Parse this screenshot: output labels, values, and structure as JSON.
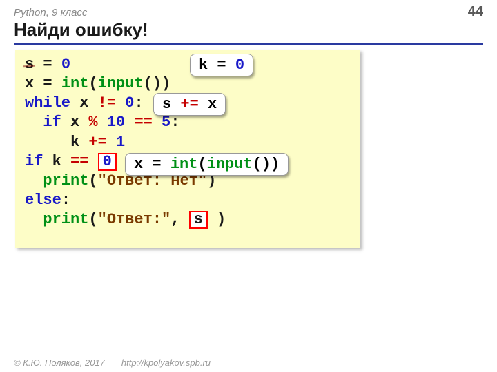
{
  "header": {
    "left": "Python, 9 класс",
    "page": "44"
  },
  "title": "Найди ошибку!",
  "code": {
    "l1": {
      "a": "s",
      "b": " = ",
      "c": "0"
    },
    "l2": {
      "a": "x = ",
      "b": "int",
      "c": "(",
      "d": "input",
      "e": "())"
    },
    "l3": {
      "a": "while",
      "b": " x ",
      "c": "!=",
      "d": " ",
      "e": "0",
      "f": ":"
    },
    "l4": {
      "a": "  ",
      "b": "if",
      "c": " x ",
      "d": "%",
      "e": " ",
      "f": "10",
      "g": " ",
      "h": "==",
      "i": " ",
      "j": "5",
      "k": ":"
    },
    "l5": {
      "a": "     k ",
      "b": "+=",
      "c": " ",
      "d": "1"
    },
    "l6": {
      "a": "if",
      "b": " k ",
      "c": "==",
      "d": " ",
      "e": "0",
      "f": " :"
    },
    "l7": {
      "a": "  ",
      "b": "print",
      "c": "(",
      "d": "\"Ответ: нет\"",
      "e": ")"
    },
    "l8": {
      "a": "else",
      "b": ":"
    },
    "l9": {
      "a": "  ",
      "b": "print",
      "c": "(",
      "d": "\"Ответ:\"",
      "e": ", ",
      "f": "s",
      "g": " )"
    }
  },
  "answers": {
    "a1": {
      "a": "k = ",
      "b": "0"
    },
    "a2": {
      "a": "s ",
      "b": "+=",
      "c": " x"
    },
    "a3": {
      "a": "x = ",
      "b": "int",
      "c": "(",
      "d": "input",
      "e": "())"
    }
  },
  "footer": {
    "copyright": "© К.Ю. Поляков, 2017",
    "url": "http://kpolyakov.spb.ru"
  }
}
